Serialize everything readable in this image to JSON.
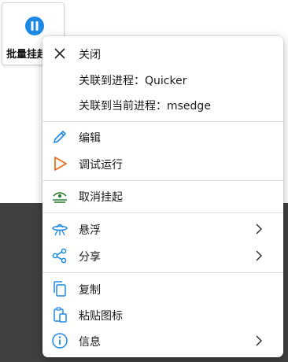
{
  "action_button": {
    "label": "批量挂起",
    "icon": "pause-circle-icon"
  },
  "menu": {
    "items": [
      {
        "label": "关闭",
        "icon": "close-icon"
      },
      {
        "label": "关联到进程：Quicker"
      },
      {
        "label": "关联到当前进程：msedge"
      },
      {
        "label": "编辑",
        "icon": "pencil-icon"
      },
      {
        "label": "调试运行",
        "icon": "play-icon"
      },
      {
        "label": "取消挂起",
        "icon": "unhide-icon"
      },
      {
        "label": "悬浮",
        "icon": "ufo-icon",
        "submenu": true
      },
      {
        "label": "分享",
        "icon": "share-icon",
        "submenu": true
      },
      {
        "label": "复制",
        "icon": "copy-icon"
      },
      {
        "label": "粘贴图标",
        "icon": "paste-icon"
      },
      {
        "label": "信息",
        "icon": "info-icon",
        "submenu": true
      }
    ]
  },
  "colors": {
    "accent_blue": "#1e88e5",
    "play_orange": "#f26b1d",
    "unhide_green": "#2e7d32",
    "dark_background": "#404040"
  }
}
